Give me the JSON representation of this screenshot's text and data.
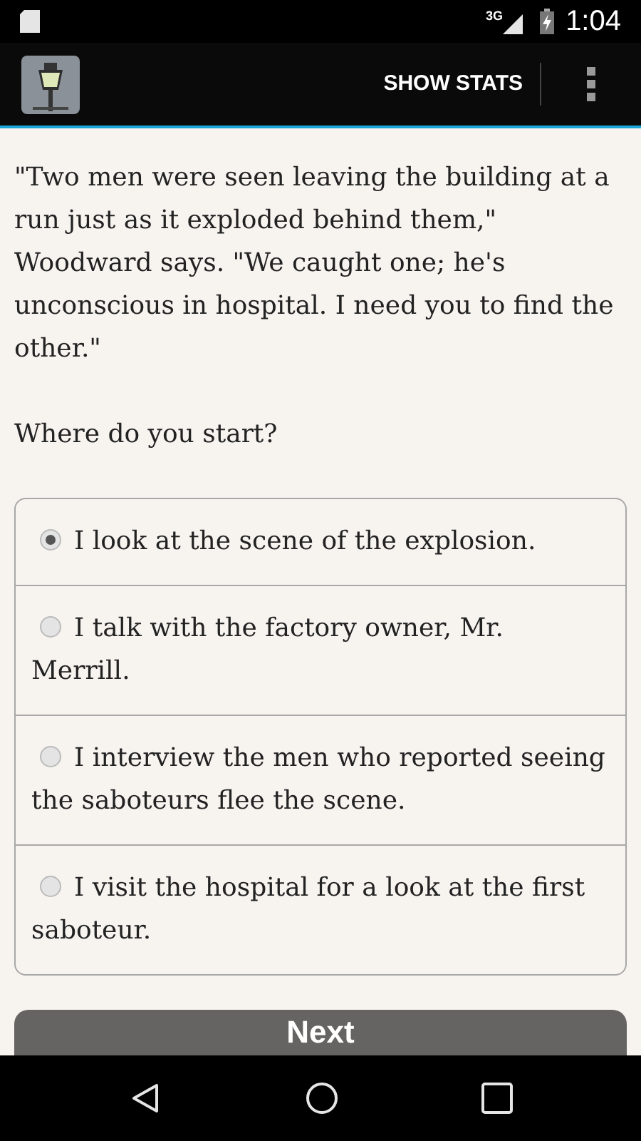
{
  "status_bar": {
    "time": "1:04",
    "network": "3G"
  },
  "action_bar": {
    "action": "SHOW STATS"
  },
  "story": [
    "\"Two men were seen leaving the building at a run just as it exploded behind them,\" Woodward says. \"We caught one; he's unconscious in hospital. I need you to find the other.\"",
    "Where do you start?"
  ],
  "choices": [
    {
      "label": "I look at the scene of the explosion.",
      "selected": true
    },
    {
      "label": "I talk with the factory owner, Mr. Merrill.",
      "selected": false
    },
    {
      "label": "I interview the men who reported seeing the saboteurs flee the scene.",
      "selected": false
    },
    {
      "label": "I visit the hospital for a look at the first saboteur.",
      "selected": false
    }
  ],
  "next_button": "Next"
}
